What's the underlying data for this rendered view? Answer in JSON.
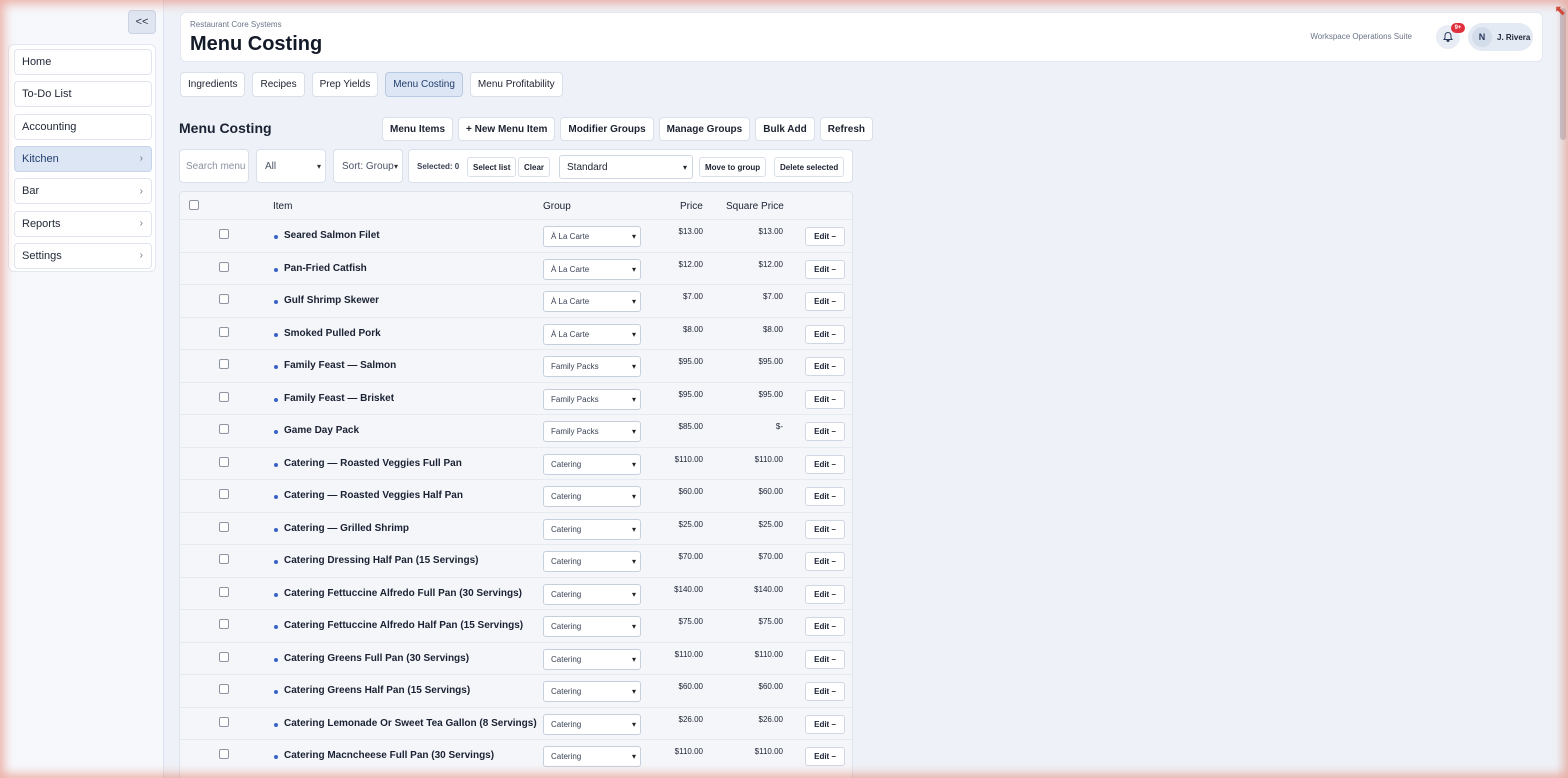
{
  "sidebar": {
    "collapse_label": "<<",
    "items": [
      {
        "label": "Home",
        "chevron": ""
      },
      {
        "label": "To-Do List",
        "chevron": ""
      },
      {
        "label": "Accounting",
        "chevron": ""
      },
      {
        "label": "Kitchen",
        "chevron": "›"
      },
      {
        "label": "Bar",
        "chevron": "›"
      },
      {
        "label": "Reports",
        "chevron": "›"
      },
      {
        "label": "Settings",
        "chevron": "›"
      }
    ],
    "active_item": "Kitchen"
  },
  "header": {
    "subtitle": "Restaurant Core Systems",
    "title": "Menu Costing",
    "suite_label": "Workspace Operations Suite",
    "notification_badge": "9+",
    "user_initial": "N",
    "user_name": "J. Rivera"
  },
  "tabs": [
    {
      "label": "Ingredients"
    },
    {
      "label": "Recipes"
    },
    {
      "label": "Prep Yields"
    },
    {
      "label": "Menu Costing"
    },
    {
      "label": "Menu Profitability"
    }
  ],
  "active_tab": "Menu Costing",
  "section": {
    "title": "Menu Costing",
    "buttons": {
      "menu_items": "Menu Items",
      "new_item": "+ New Menu Item",
      "modifier_groups": "Modifier Groups",
      "manage_groups": "Manage Groups",
      "bulk_add": "Bulk Add",
      "refresh": "Refresh"
    }
  },
  "filters": {
    "search_placeholder": "Search menu",
    "filter_value": "All",
    "sort_value": "Sort: Group",
    "selected_label": "Selected: 0",
    "select_list": "Select list",
    "clear": "Clear",
    "mode_value": "Standard",
    "move_to_group": "Move to group",
    "delete_selected": "Delete selected"
  },
  "table": {
    "headers": {
      "item": "Item",
      "group": "Group",
      "price": "Price",
      "square_price": "Square Price"
    },
    "edit_label": "Edit –",
    "rows": [
      {
        "name": "Seared Salmon Filet",
        "group": "À La Carte",
        "price": "$13.00",
        "square_price": "$13.00"
      },
      {
        "name": "Pan-Fried Catfish",
        "group": "À La Carte",
        "price": "$12.00",
        "square_price": "$12.00"
      },
      {
        "name": "Gulf Shrimp Skewer",
        "group": "À La Carte",
        "price": "$7.00",
        "square_price": "$7.00"
      },
      {
        "name": "Smoked Pulled Pork",
        "group": "À La Carte",
        "price": "$8.00",
        "square_price": "$8.00"
      },
      {
        "name": "Family Feast — Salmon",
        "group": "Family Packs",
        "price": "$95.00",
        "square_price": "$95.00"
      },
      {
        "name": "Family Feast — Brisket",
        "group": "Family Packs",
        "price": "$95.00",
        "square_price": "$95.00"
      },
      {
        "name": "Game Day Pack",
        "group": "Family Packs",
        "price": "$85.00",
        "square_price": "$-"
      },
      {
        "name": "Catering — Roasted Veggies Full Pan",
        "group": "Catering",
        "price": "$110.00",
        "square_price": "$110.00"
      },
      {
        "name": "Catering — Roasted Veggies Half Pan",
        "group": "Catering",
        "price": "$60.00",
        "square_price": "$60.00"
      },
      {
        "name": "Catering — Grilled Shrimp",
        "group": "Catering",
        "price": "$25.00",
        "square_price": "$25.00"
      },
      {
        "name": "Catering Dressing Half Pan (15 Servings)",
        "group": "Catering",
        "price": "$70.00",
        "square_price": "$70.00"
      },
      {
        "name": "Catering Fettuccine Alfredo Full Pan (30 Servings)",
        "group": "Catering",
        "price": "$140.00",
        "square_price": "$140.00"
      },
      {
        "name": "Catering Fettuccine Alfredo Half Pan (15 Servings)",
        "group": "Catering",
        "price": "$75.00",
        "square_price": "$75.00"
      },
      {
        "name": "Catering Greens Full Pan (30 Servings)",
        "group": "Catering",
        "price": "$110.00",
        "square_price": "$110.00"
      },
      {
        "name": "Catering Greens Half Pan (15 Servings)",
        "group": "Catering",
        "price": "$60.00",
        "square_price": "$60.00"
      },
      {
        "name": "Catering Lemonade Or Sweet Tea Gallon (8 Servings)",
        "group": "Catering",
        "price": "$26.00",
        "square_price": "$26.00"
      },
      {
        "name": "Catering Macncheese Full Pan (30 Servings)",
        "group": "Catering",
        "price": "$110.00",
        "square_price": "$110.00"
      }
    ]
  }
}
